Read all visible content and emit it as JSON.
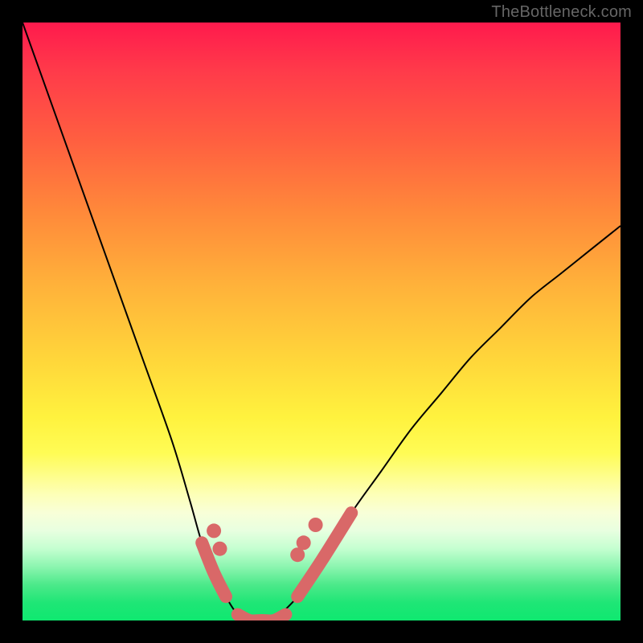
{
  "watermark": "TheBottleneck.com",
  "colors": {
    "background": "#000000",
    "curve": "#000000",
    "marker": "#d96868",
    "gradient_top": "#ff1a4d",
    "gradient_mid": "#fff23e",
    "gradient_bottom": "#0fe870"
  },
  "chart_data": {
    "type": "line",
    "title": "",
    "xlabel": "",
    "ylabel": "",
    "xlim": [
      0,
      100
    ],
    "ylim": [
      0,
      100
    ],
    "grid": false,
    "series": [
      {
        "name": "left-curve",
        "x": [
          0,
          5,
          10,
          15,
          20,
          25,
          28,
          30,
          32,
          34,
          36,
          38
        ],
        "y": [
          100,
          86,
          72,
          58,
          44,
          30,
          20,
          13,
          8,
          4,
          1,
          0
        ]
      },
      {
        "name": "right-curve",
        "x": [
          42,
          46,
          50,
          55,
          60,
          65,
          70,
          75,
          80,
          85,
          90,
          95,
          100
        ],
        "y": [
          0,
          4,
          10,
          18,
          25,
          32,
          38,
          44,
          49,
          54,
          58,
          62,
          66
        ]
      },
      {
        "name": "valley-floor",
        "x": [
          36,
          38,
          40,
          42,
          44
        ],
        "y": [
          1,
          0,
          0,
          0,
          1
        ]
      }
    ],
    "markers": [
      {
        "name": "left-dot-upper",
        "x": 32,
        "y": 15
      },
      {
        "name": "left-dot-lower",
        "x": 33,
        "y": 12
      },
      {
        "name": "right-dot-1",
        "x": 46,
        "y": 11
      },
      {
        "name": "right-dot-2",
        "x": 47,
        "y": 13
      },
      {
        "name": "right-dot-3",
        "x": 49,
        "y": 16
      }
    ],
    "annotations": []
  }
}
